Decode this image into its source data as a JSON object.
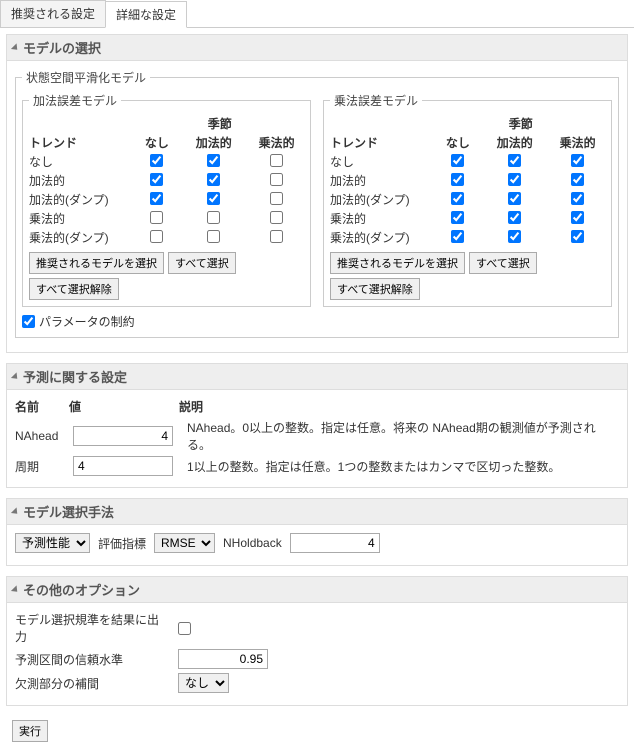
{
  "tabs": {
    "recommended": "推奨される設定",
    "advanced": "詳細な設定"
  },
  "section1": {
    "title": "モデルの選択",
    "outer_legend": "状態空間平滑化モデル",
    "additive_legend": "加法誤差モデル",
    "multiplicative_legend": "乗法誤差モデル",
    "season_header": "季節",
    "trend_header": "トレンド",
    "cols": {
      "none": "なし",
      "add": "加法的",
      "mult": "乗法的"
    },
    "rows": {
      "none": "なし",
      "add": "加法的",
      "add_damp": "加法的(ダンプ)",
      "mult": "乗法的",
      "mult_damp": "乗法的(ダンプ)"
    },
    "btn_recommended": "推奨されるモデルを選択",
    "btn_all": "すべて選択",
    "btn_none": "すべて選択解除",
    "param_constraint": "パラメータの制約"
  },
  "section2": {
    "title": "予測に関する設定",
    "h_name": "名前",
    "h_value": "値",
    "h_desc": "説明",
    "r1_name": "NAhead",
    "r1_value": "4",
    "r1_desc": "NAhead。0以上の整数。指定は任意。将来の NAhead期の観測値が予測される。",
    "r2_name": "周期",
    "r2_value": "4",
    "r2_desc": "1以上の整数。指定は任意。1つの整数またはカンマで区切った整数。"
  },
  "section3": {
    "title": "モデル選択手法",
    "sel_method": "予測性能",
    "lbl_metric": "評価指標",
    "sel_metric": "RMSE",
    "lbl_nhold": "NHoldback",
    "val_nhold": "4"
  },
  "section4": {
    "title": "その他のオプション",
    "l1": "モデル選択規準を結果に出力",
    "l2": "予測区間の信頼水準",
    "v2": "0.95",
    "l3": "欠測部分の補間",
    "sel3": "なし"
  },
  "execute": "実行"
}
